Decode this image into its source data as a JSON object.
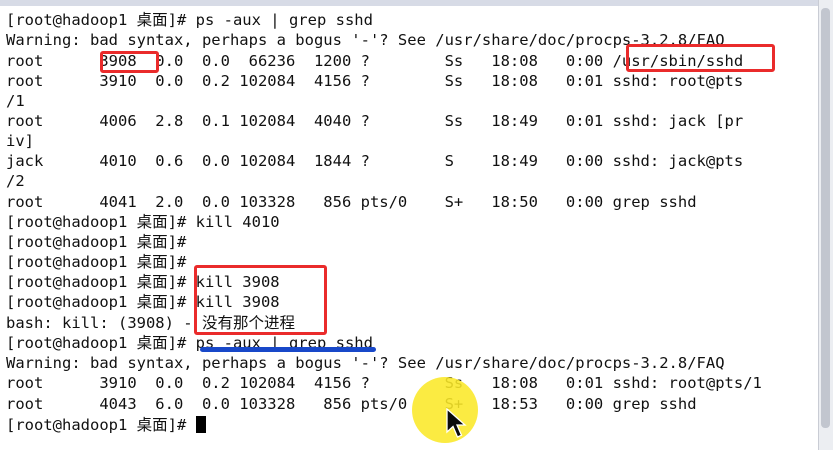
{
  "terminal": {
    "lines": [
      "[root@hadoop1 桌面]# ps -aux | grep sshd",
      "Warning: bad syntax, perhaps a bogus '-'? See /usr/share/doc/procps-3.2.8/FAQ",
      "root      3908  0.0  0.0  66236  1200 ?        Ss   18:08   0:00 /usr/sbin/sshd",
      "root      3910  0.0  0.2 102084  4156 ?        Ss   18:08   0:01 sshd: root@pts",
      "/1",
      "root      4006  2.8  0.1 102084  4040 ?        Ss   18:49   0:01 sshd: jack [pr",
      "iv]",
      "jack      4010  0.6  0.0 102084  1844 ?        S    18:49   0:00 sshd: jack@pts",
      "/2",
      "root      4041  2.0  0.0 103328   856 pts/0    S+   18:50   0:00 grep sshd",
      "[root@hadoop1 桌面]# kill 4010",
      "[root@hadoop1 桌面]#",
      "[root@hadoop1 桌面]#",
      "[root@hadoop1 桌面]# kill 3908",
      "[root@hadoop1 桌面]# kill 3908",
      "bash: kill: (3908) - 没有那个进程",
      "[root@hadoop1 桌面]# ps -aux | grep sshd",
      "Warning: bad syntax, perhaps a bogus '-'? See /usr/share/doc/procps-3.2.8/FAQ",
      "root      3910  0.0  0.2 102084  4156 ?        Ss   18:08   0:01 sshd: root@pts/1",
      "root      4043  6.0  0.0 103328   856 pts/0    S+   18:53   0:00 grep sshd",
      "[root@hadoop1 桌面]# "
    ]
  },
  "colors": {
    "background": "#ffffff",
    "text": "#111111",
    "highlight_box": "#ea2b2b",
    "underline": "#1848c9",
    "pointer_glow": "#fae828"
  },
  "icons": {
    "cursor": "block-cursor",
    "mouse": "mouse-pointer-icon"
  }
}
